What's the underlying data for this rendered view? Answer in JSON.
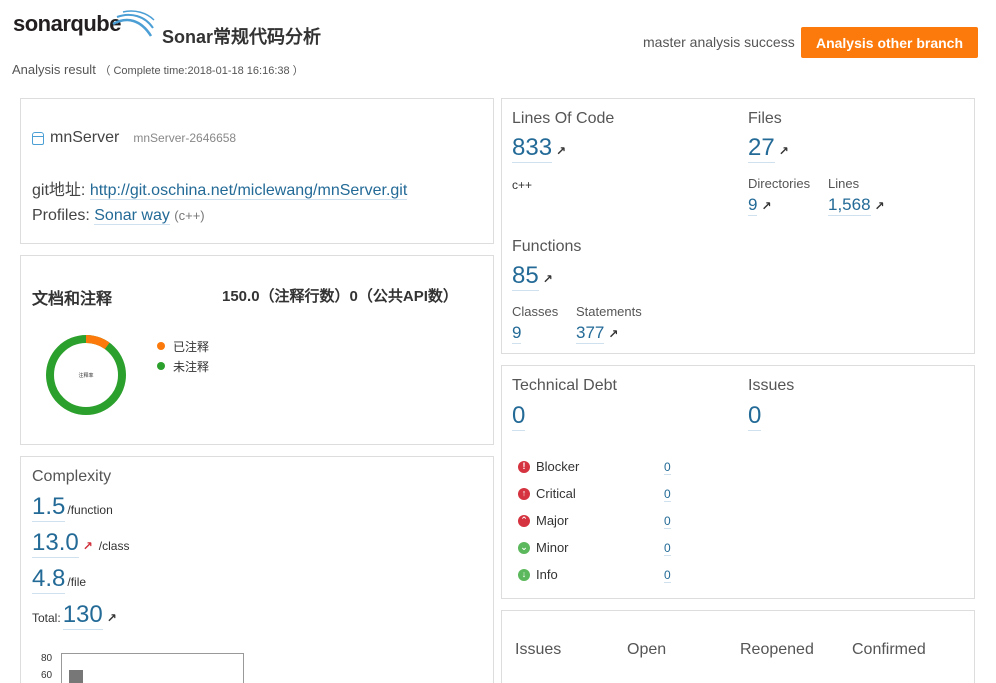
{
  "header": {
    "logo_text_a": "sonar",
    "logo_text_b": "qube",
    "app_title": "Sonar常规代码分析",
    "subtitle": "Analysis result",
    "complete_time": "（ Complete time:2018-01-18 16:16:38 ）",
    "status": "master analysis success",
    "other_branch_label": "Analysis other branch",
    "accent": "#fb7a0b"
  },
  "project": {
    "name": "mnServer",
    "key": "mnServer-2646658",
    "git_label": "git地址:",
    "git_url": "http://git.oschina.net/miclewang/mnServer.git",
    "profiles_label": "Profiles:",
    "profile_name": "Sonar way",
    "profile_lang": "(c++)"
  },
  "comments": {
    "title": "文档和注释",
    "stat": "150.0（注释行数）0（公共API数）",
    "donut_center": "注释率",
    "legend": [
      {
        "label": "已注释",
        "color": "#fb7a0b"
      },
      {
        "label": "未注释",
        "color": "#2ca02c"
      }
    ],
    "commented_fraction": 0.1
  },
  "complexity": {
    "title": "Complexity",
    "per_function": "1.5",
    "per_function_unit": "/function",
    "per_class": "13.0",
    "per_class_unit": "/class",
    "per_file": "4.8",
    "per_file_unit": "/file",
    "total_label": "Total:",
    "total": "130",
    "chart": {
      "ticks": [
        "80",
        "60"
      ]
    }
  },
  "size": {
    "loc_label": "Lines Of Code",
    "loc": "833",
    "language": "c++",
    "files_label": "Files",
    "files": "27",
    "directories_label": "Directories",
    "directories": "9",
    "lines_label": "Lines",
    "lines": "1,568",
    "functions_label": "Functions",
    "functions": "85",
    "classes_label": "Classes",
    "classes": "9",
    "statements_label": "Statements",
    "statements": "377"
  },
  "debt": {
    "title": "Technical Debt",
    "value": "0",
    "issues_label": "Issues",
    "issues": "0",
    "severities": [
      {
        "label": "Blocker",
        "value": "0",
        "color": "#d4333f",
        "icon": "!"
      },
      {
        "label": "Critical",
        "value": "0",
        "color": "#d4333f",
        "icon": "↑"
      },
      {
        "label": "Major",
        "value": "0",
        "color": "#d4333f",
        "icon": "^"
      },
      {
        "label": "Minor",
        "value": "0",
        "color": "#5cb85c",
        "icon": "v"
      },
      {
        "label": "Info",
        "value": "0",
        "color": "#5cb85c",
        "icon": "↓"
      }
    ]
  },
  "issues_table": {
    "headers": [
      "Issues",
      "Open",
      "Reopened",
      "Confirmed"
    ]
  }
}
